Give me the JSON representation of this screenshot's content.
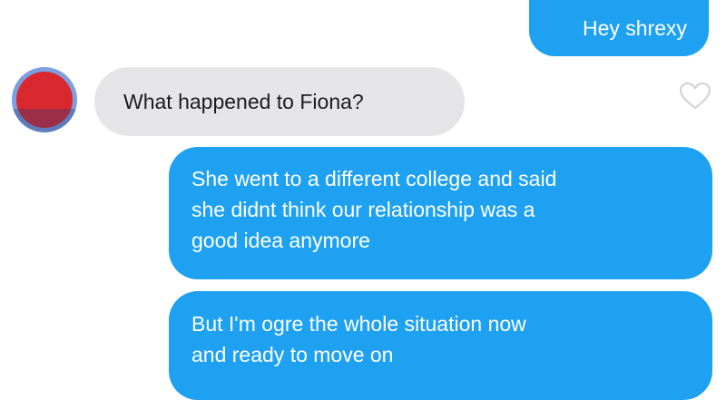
{
  "colors": {
    "outgoing_bubble": "#1ea1f1",
    "incoming_bubble": "#e5e5e7",
    "avatar": "#d9282e",
    "heart_outline": "#d4d4d4"
  },
  "contact": {
    "avatar_icon": "profile-photo"
  },
  "messages": [
    {
      "direction": "outgoing",
      "lines": [
        "Hey shrexy"
      ]
    },
    {
      "direction": "incoming",
      "lines": [
        "What happened to Fiona?"
      ],
      "like_icon": "heart-outline-icon"
    },
    {
      "direction": "outgoing",
      "lines": [
        "She went to a different college and said",
        "she didnt think our relationship was a",
        "good idea anymore"
      ]
    },
    {
      "direction": "outgoing",
      "lines": [
        "But I'm ogre the whole situation now",
        "and ready to move on"
      ]
    }
  ]
}
